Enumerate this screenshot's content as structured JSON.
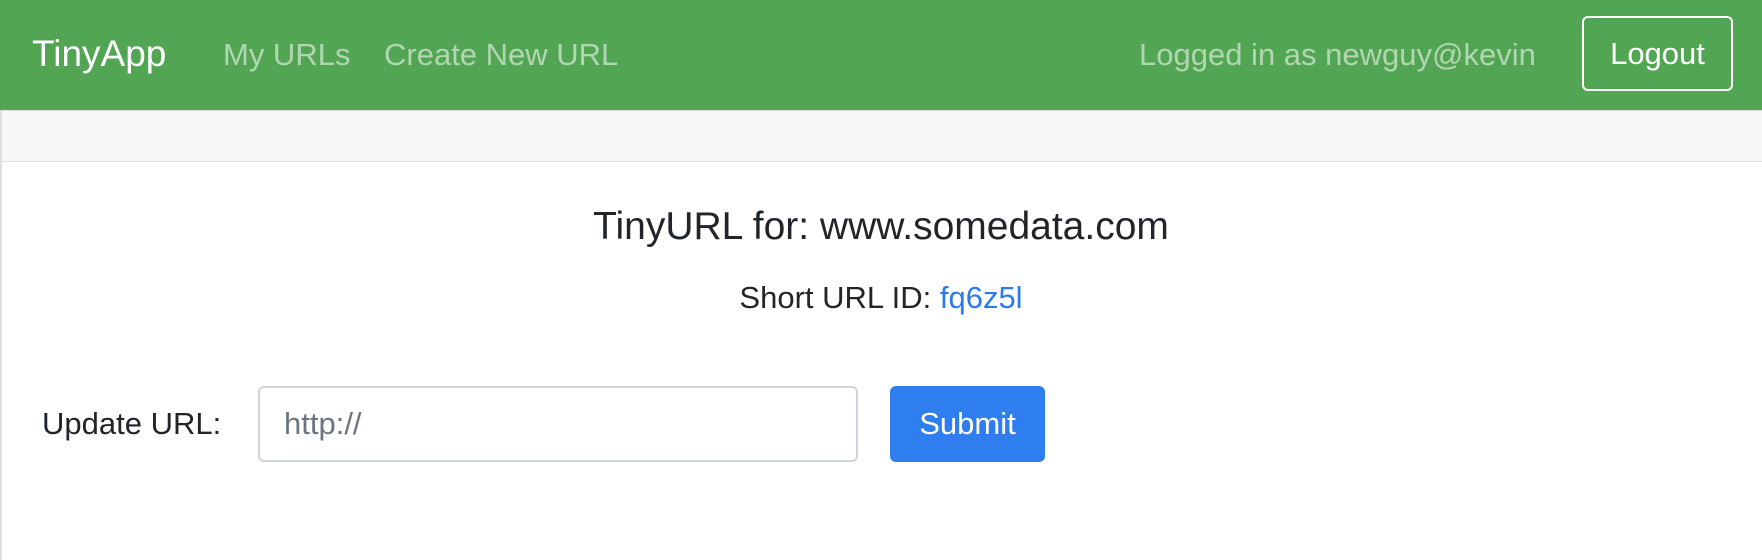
{
  "navbar": {
    "brand": "TinyApp",
    "links": [
      {
        "label": "My URLs"
      },
      {
        "label": "Create New URL"
      }
    ],
    "logged_in_text": "Logged in as newguy@kevin",
    "logout_label": "Logout",
    "background_color": "#52a552"
  },
  "main": {
    "title": "TinyURL for: www.somedata.com",
    "short_url_prefix": "Short URL ID: ",
    "short_url_id": "fq6z5l",
    "update_label": "Update URL:",
    "url_input": {
      "value": "",
      "placeholder": "http://"
    },
    "submit_label": "Submit",
    "accent_color": "#2f7ef0"
  }
}
